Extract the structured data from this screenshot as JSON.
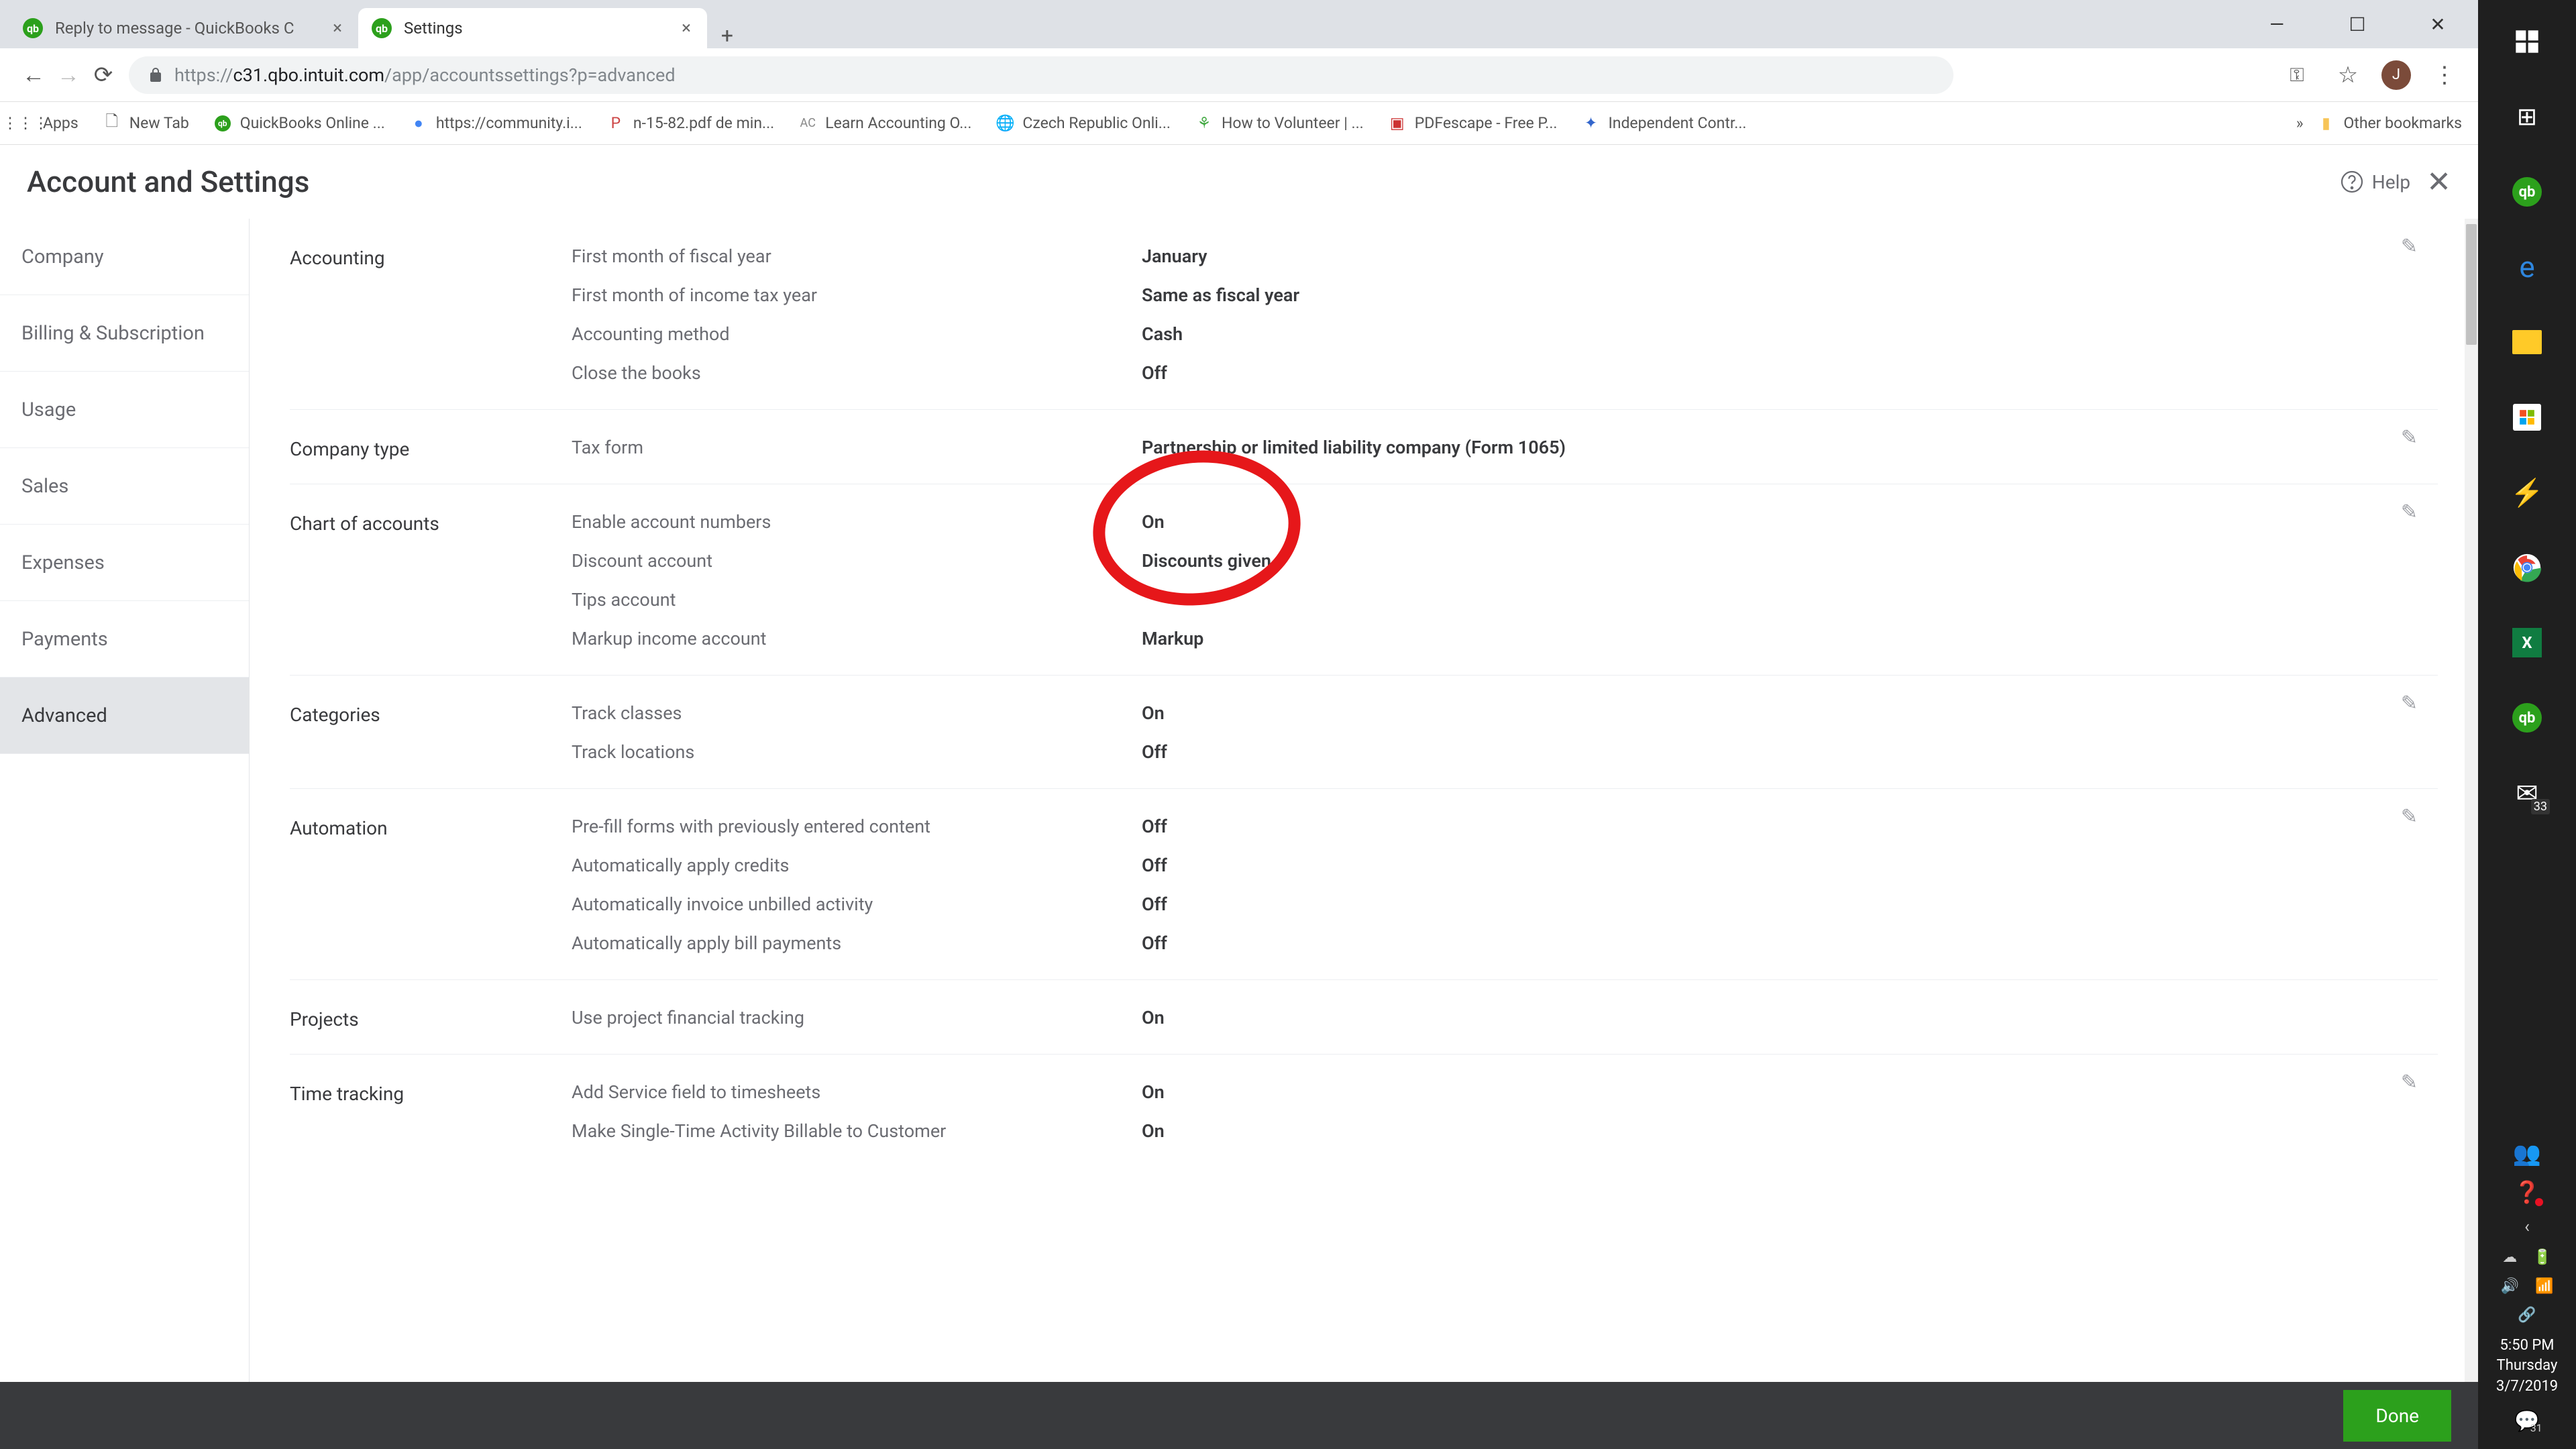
{
  "tabs": {
    "inactive": "Reply to message - QuickBooks C",
    "active": "Settings"
  },
  "url_host": "c31.qbo.intuit.com",
  "url_path": "/app/accountssettings?p=advanced",
  "bookmarks": [
    "Apps",
    "New Tab",
    "QuickBooks Online ...",
    "https://community.i...",
    "n-15-82.pdf de min...",
    "Learn Accounting O...",
    "Czech Republic Onli...",
    "How to Volunteer | ...",
    "PDFescape - Free P...",
    "Independent Contr..."
  ],
  "other_bm": "Other bookmarks",
  "avatar_letter": "J",
  "page_title": "Account and Settings",
  "help_label": "Help",
  "nav": [
    "Company",
    "Billing & Subscription",
    "Usage",
    "Sales",
    "Expenses",
    "Payments",
    "Advanced"
  ],
  "nav_active_index": 6,
  "sections": {
    "accounting": {
      "title": "Accounting",
      "rows": [
        {
          "label": "First month of fiscal year",
          "value": "January"
        },
        {
          "label": "First month of income tax year",
          "value": "Same as fiscal year"
        },
        {
          "label": "Accounting method",
          "value": "Cash"
        },
        {
          "label": "Close the books",
          "value": "Off"
        }
      ]
    },
    "company_type": {
      "title": "Company type",
      "rows": [
        {
          "label": "Tax form",
          "value": "Partnership or limited liability company (Form 1065)"
        }
      ]
    },
    "chart": {
      "title": "Chart of accounts",
      "rows": [
        {
          "label": "Enable account numbers",
          "value": "On"
        },
        {
          "label": "Discount account",
          "value": "Discounts given"
        },
        {
          "label": "Tips account",
          "value": ""
        },
        {
          "label": "Markup income account",
          "value": "Markup"
        }
      ]
    },
    "categories": {
      "title": "Categories",
      "rows": [
        {
          "label": "Track classes",
          "value": "On"
        },
        {
          "label": "Track locations",
          "value": "Off"
        }
      ]
    },
    "automation": {
      "title": "Automation",
      "rows": [
        {
          "label": "Pre-fill forms with previously entered content",
          "value": "Off"
        },
        {
          "label": "Automatically apply credits",
          "value": "Off"
        },
        {
          "label": "Automatically invoice unbilled activity",
          "value": "Off"
        },
        {
          "label": "Automatically apply bill payments",
          "value": "Off"
        }
      ]
    },
    "projects": {
      "title": "Projects",
      "rows": [
        {
          "label": "Use project financial tracking",
          "value": "On"
        }
      ]
    },
    "time": {
      "title": "Time tracking",
      "rows": [
        {
          "label": "Add Service field to timesheets",
          "value": "On"
        },
        {
          "label": "Make Single-Time Activity Billable to Customer",
          "value": "On"
        }
      ]
    }
  },
  "done_label": "Done",
  "mail_badge": "33",
  "clock": {
    "time": "5:50 PM",
    "day": "Thursday",
    "date": "3/7/2019"
  },
  "sticky_badge": "31"
}
